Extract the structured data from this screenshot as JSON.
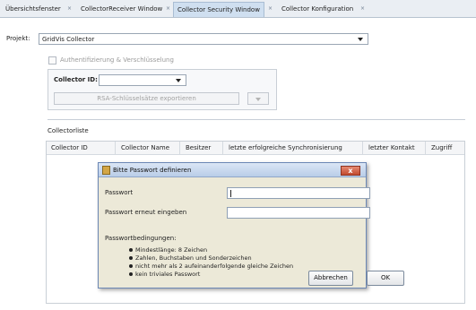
{
  "tabs": [
    {
      "label": "Übersichtsfenster",
      "active": false
    },
    {
      "label": "CollectorReceiver Window",
      "active": false
    },
    {
      "label": "Collector Security Window",
      "active": true
    },
    {
      "label": "Collector Konfiguration",
      "active": false
    }
  ],
  "tab_close_glyph": "×",
  "project": {
    "label": "Projekt:",
    "value": "GridVis Collector"
  },
  "auth": {
    "label": "Authentifizierung & Verschlüsselung",
    "checked": false
  },
  "collector_id": {
    "label": "Collector ID:",
    "value": ""
  },
  "rsa_export_button": "RSA-Schlüsselsätze exportieren",
  "collector_list": {
    "title": "Collectorliste",
    "columns": [
      "Collector ID",
      "Collector Name",
      "Besitzer",
      "letzte erfolgreiche Synchronisierung",
      "letzter Kontakt",
      "Zugriff"
    ]
  },
  "dialog": {
    "title": "Bitte Passwort definieren",
    "close_glyph": "x",
    "password_label": "Passwort",
    "password_repeat_label": "Passwort erneut eingeben",
    "conditions_title": "Passwortbedingungen:",
    "conditions": [
      "Mindestlänge: 8 Zeichen",
      "Zahlen, Buchstaben und Sonderzeichen",
      "nicht mehr als 2 aufeinanderfolgende gleiche Zeichen",
      "kein triviales Passwort"
    ],
    "cancel_button": "Abbrechen",
    "ok_button": "OK"
  },
  "colors": {
    "accent": "#cfdff0",
    "dialog_bg": "#ece9d8",
    "close_red": "#c24a2e"
  }
}
